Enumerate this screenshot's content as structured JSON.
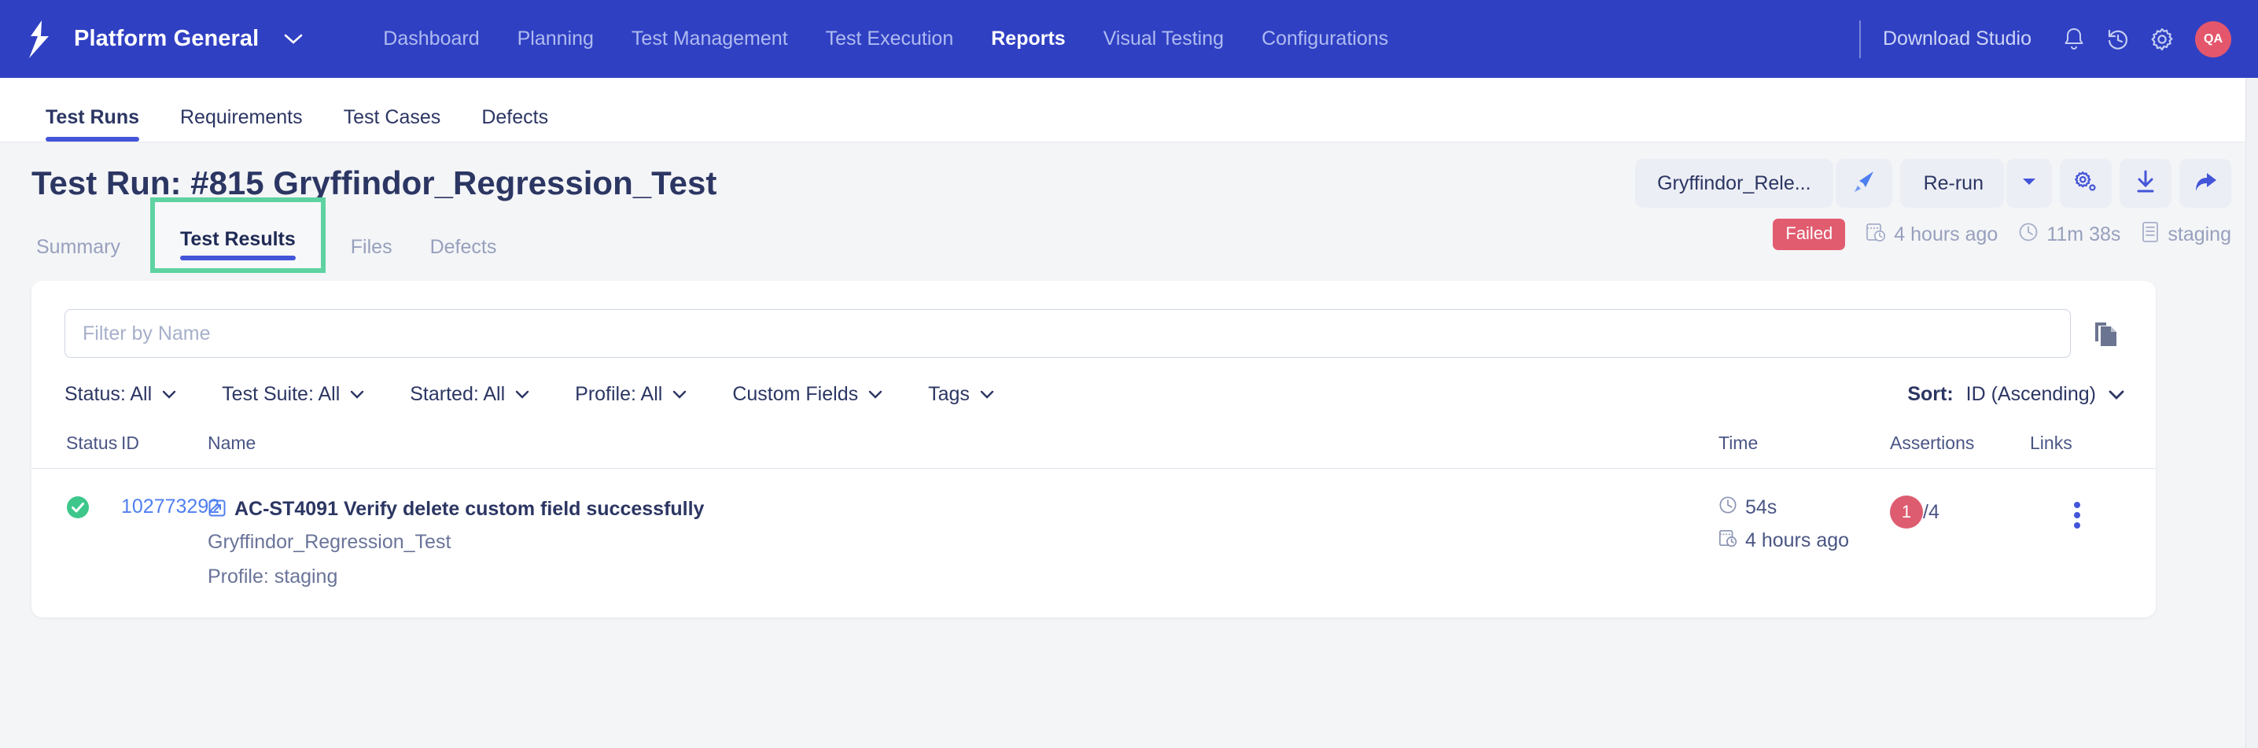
{
  "topnav": {
    "brand": "Platform General",
    "links": [
      {
        "label": "Dashboard",
        "active": false
      },
      {
        "label": "Planning",
        "active": false
      },
      {
        "label": "Test Management",
        "active": false
      },
      {
        "label": "Test Execution",
        "active": false
      },
      {
        "label": "Reports",
        "active": true
      },
      {
        "label": "Visual Testing",
        "active": false
      },
      {
        "label": "Configurations",
        "active": false
      }
    ],
    "download_studio": "Download Studio",
    "avatar_initials": "QA",
    "colors": {
      "bar": "#3040c3",
      "avatar": "#e4566c"
    }
  },
  "subtabs": [
    {
      "label": "Test Runs",
      "active": true
    },
    {
      "label": "Requirements",
      "active": false
    },
    {
      "label": "Test Cases",
      "active": false
    },
    {
      "label": "Defects",
      "active": false
    }
  ],
  "header": {
    "title": "Test Run: #815 Gryffindor_Regression_Test",
    "release_pill": "Gryffindor_Rele...",
    "rerun_label": "Re-run"
  },
  "tabs2": [
    {
      "label": "Summary",
      "active": false
    },
    {
      "label": "Test Results",
      "active": true
    },
    {
      "label": "Files",
      "active": false
    },
    {
      "label": "Defects",
      "active": false
    }
  ],
  "annotation": {
    "color": "#5fd2a2",
    "around": "Test Results"
  },
  "meta": {
    "status": "Failed",
    "status_color": "#e25c70",
    "started": "4 hours ago",
    "duration": "11m 38s",
    "profile": "staging"
  },
  "filters": {
    "search_placeholder": "Filter by Name",
    "search_value": "",
    "dropdowns": [
      {
        "label": "Status: All"
      },
      {
        "label": "Test Suite: All"
      },
      {
        "label": "Started: All"
      },
      {
        "label": "Profile: All"
      },
      {
        "label": "Custom Fields"
      },
      {
        "label": "Tags"
      }
    ],
    "sort_label": "Sort:",
    "sort_value": "ID (Ascending)"
  },
  "table": {
    "columns": [
      "Status",
      "ID",
      "Name",
      "Time",
      "Assertions",
      "Links"
    ],
    "rows": [
      {
        "status": "passed",
        "id": "102773292",
        "name": "AC-ST4091 Verify delete custom field successfully",
        "suite": "Gryffindor_Regression_Test",
        "profile": "Profile: staging",
        "duration": "54s",
        "started": "4 hours ago",
        "assertions_failed": "1",
        "assertions_total": "/4"
      }
    ]
  }
}
